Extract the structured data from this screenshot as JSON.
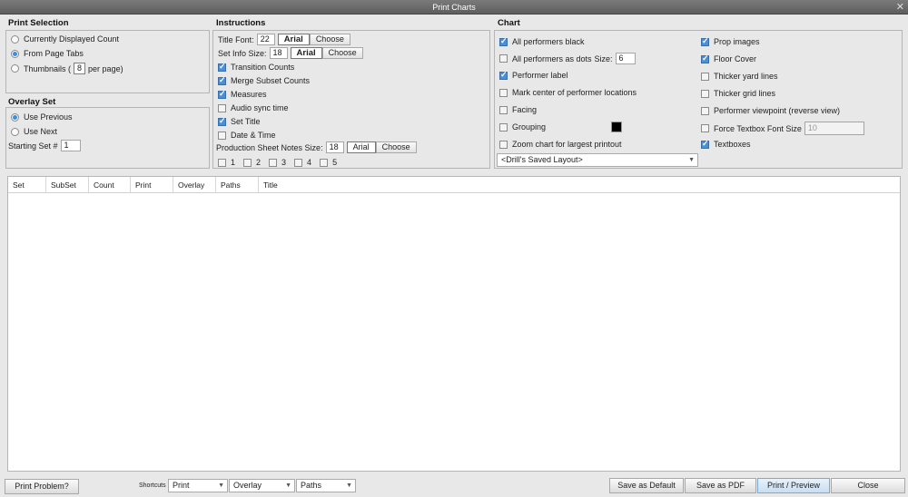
{
  "window": {
    "title": "Print Charts",
    "close_glyph": "✕"
  },
  "print_selection": {
    "title": "Print Selection",
    "options": [
      "Currently Displayed Count",
      "From Page Tabs",
      "Thumbnails ("
    ],
    "selected_index": 1,
    "thumbnails_count": "8",
    "thumbnails_suffix": "per page)"
  },
  "overlay_set": {
    "title": "Overlay Set",
    "options": [
      "Use Previous",
      "Use Next"
    ],
    "selected_index": 0,
    "starting_set_label": "Starting Set #",
    "starting_set_value": "1"
  },
  "instructions": {
    "title": "Instructions",
    "title_font_label": "Title Font:",
    "title_font_size": "22",
    "title_font_name": "Arial",
    "set_info_label": "Set Info Size:",
    "set_info_size": "18",
    "set_info_font": "Arial",
    "choose_label": "Choose",
    "checks": [
      {
        "label": "Transition Counts",
        "checked": true
      },
      {
        "label": "Merge Subset Counts",
        "checked": true
      },
      {
        "label": "Measures",
        "checked": true
      },
      {
        "label": "Audio sync time",
        "checked": false
      },
      {
        "label": "Set Title",
        "checked": true
      },
      {
        "label": "Date & Time",
        "checked": false
      }
    ],
    "notes_label": "Production Sheet Notes Size:",
    "notes_size": "18",
    "notes_font": "Arial",
    "notes_checks": [
      "1",
      "2",
      "3",
      "4",
      "5"
    ]
  },
  "chart": {
    "title": "Chart",
    "left_checks": [
      {
        "label": "All performers black",
        "checked": true
      },
      {
        "label": "All performers as dots",
        "checked": false
      },
      {
        "label": "Performer label",
        "checked": true
      },
      {
        "label": "Mark center of performer locations",
        "checked": false
      },
      {
        "label": "Facing",
        "checked": false
      },
      {
        "label": "Grouping",
        "checked": false
      },
      {
        "label": "Zoom chart for largest printout",
        "checked": false
      }
    ],
    "dots_size_label": "Size:",
    "dots_size_value": "6",
    "grouping_color": "#000000",
    "right_checks": [
      {
        "label": "Prop images",
        "checked": true
      },
      {
        "label": "Floor Cover",
        "checked": true
      },
      {
        "label": "Thicker yard lines",
        "checked": false
      },
      {
        "label": "Thicker grid lines",
        "checked": false
      },
      {
        "label": "Performer viewpoint (reverse view)",
        "checked": false
      },
      {
        "label": "Force Textbox Font Size",
        "checked": false
      },
      {
        "label": "Textboxes",
        "checked": true
      }
    ],
    "force_font_value": "10",
    "layout_select": "<Drill's Saved Layout>"
  },
  "table": {
    "columns": [
      "Set",
      "SubSet",
      "Count",
      "Print",
      "Overlay",
      "Paths",
      "Title"
    ]
  },
  "footer": {
    "print_problem": "Print Problem?",
    "shortcuts_label": "Shortcuts",
    "shortcut_selects": [
      "Print",
      "Overlay",
      "Paths"
    ],
    "save_default": "Save as Default",
    "save_pdf": "Save as PDF",
    "print_preview": "Print / Preview",
    "close": "Close"
  }
}
